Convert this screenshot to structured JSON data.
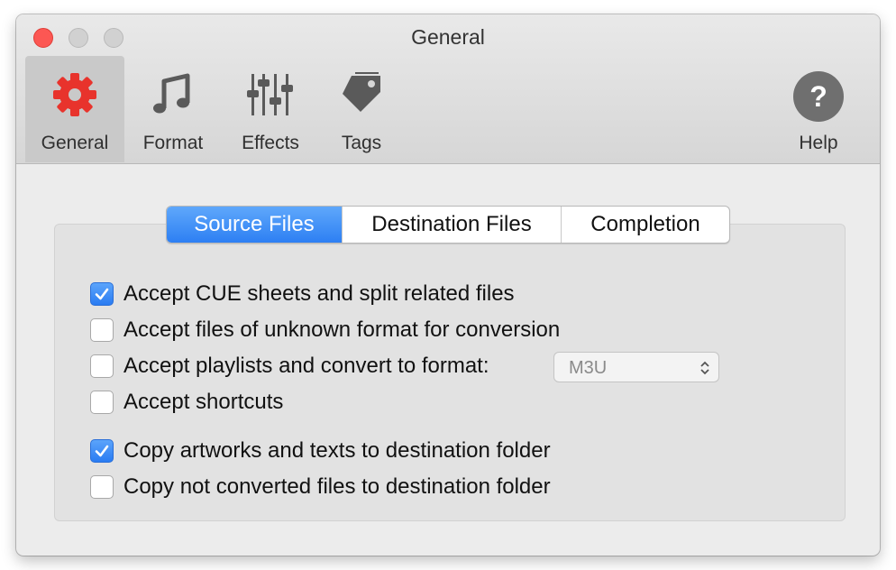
{
  "window": {
    "title": "General"
  },
  "toolbar": {
    "items": [
      {
        "label": "General",
        "icon": "gear-icon",
        "selected": true
      },
      {
        "label": "Format",
        "icon": "music-note-icon"
      },
      {
        "label": "Effects",
        "icon": "sliders-icon"
      },
      {
        "label": "Tags",
        "icon": "tag-icon"
      },
      {
        "label": "Help",
        "icon": "help-icon"
      }
    ]
  },
  "tabs": [
    {
      "label": "Source Files",
      "active": true
    },
    {
      "label": "Destination Files"
    },
    {
      "label": "Completion"
    }
  ],
  "options": [
    {
      "label": "Accept CUE sheets and split related files",
      "checked": true
    },
    {
      "label": "Accept files of unknown format for conversion",
      "checked": false
    },
    {
      "label": "Accept playlists and convert to format:",
      "checked": false
    },
    {
      "label": "Accept shortcuts",
      "checked": false
    },
    {
      "label": "Copy artworks and texts to destination folder",
      "checked": true
    },
    {
      "label": "Copy not converted files to destination folder",
      "checked": false
    }
  ],
  "playlist_format": {
    "value": "M3U"
  },
  "colors": {
    "accent": "#2d7ff3",
    "gear": "#e8332c",
    "close": "#fc5753"
  }
}
